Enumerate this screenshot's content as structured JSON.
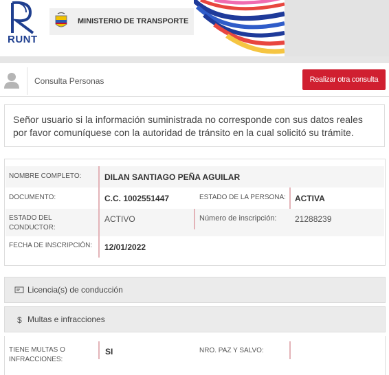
{
  "header": {
    "logo_text": "RUNT",
    "ministry_label": "MINISTERIO DE TRANSPORTE"
  },
  "subheader": {
    "title": "Consulta Personas",
    "button_label": "Realizar otra consulta"
  },
  "notice": {
    "text": "Señor usuario si la información suministrada no corresponde con sus datos reales por favor comuníquese con la autoridad de tránsito en la cual solicitó su trámite."
  },
  "person": {
    "nombre_label": "NOMBRE COMPLETO:",
    "nombre_value": "DILAN SANTIAGO PEÑA AGUILAR",
    "documento_label": "DOCUMENTO:",
    "documento_value": "C.C. 1002551447",
    "estado_persona_label": "ESTADO DE LA PERSONA:",
    "estado_persona_value": "ACTIVA",
    "estado_conductor_label_1": "ESTADO DEL",
    "estado_conductor_label_2": "CONDUCTOR:",
    "estado_conductor_value": "ACTIVO",
    "inscripcion_num_label": "Número de inscripción:",
    "inscripcion_num_value": "21288239",
    "fecha_label": "FECHA DE INSCRIPCIÓN:",
    "fecha_value": "12/01/2022"
  },
  "sections": {
    "licencias": "Licencia(s) de conducción",
    "multas": "Multas e infracciones"
  },
  "multas": {
    "tiene_label_1": "TIENE MULTAS O",
    "tiene_label_2": "INFRACCIONES:",
    "tiene_value": "SI",
    "paz_label": "NRO. PAZ Y SALVO:"
  },
  "colors": {
    "accent_red": "#d01f30",
    "brand_blue": "#1f3f8f"
  }
}
